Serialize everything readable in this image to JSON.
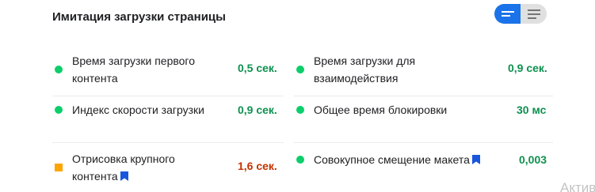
{
  "section": {
    "title": "Имитация загрузки страницы"
  },
  "metrics": [
    {
      "label_line1": "Время загрузки первого",
      "label_line2": "контента",
      "value": "0,5 сек.",
      "status": "good"
    },
    {
      "label_line1": "Время загрузки для",
      "label_line2": "взаимодействия",
      "value": "0,9 сек.",
      "status": "good"
    },
    {
      "label": "Индекс скорости загрузки",
      "value": "0,9 сек.",
      "status": "good"
    },
    {
      "label": "Общее время блокировки",
      "value": "30 мс",
      "status": "good"
    },
    {
      "label_line1": "Отрисовка крупного",
      "label_line2": "контента",
      "value": "1,6 сек.",
      "status": "average"
    },
    {
      "label": "Совокупное смещение макета",
      "value": "0,003",
      "status": "good"
    }
  ],
  "watermark": "Актив",
  "colors": {
    "good": "#0cce6b",
    "good_text": "#0d904f",
    "average": "#ffa400",
    "average_text": "#c33300",
    "accent": "#1a73e8"
  },
  "icons": {
    "toggle_left": "view-compact-icon",
    "toggle_right": "view-list-icon",
    "bookmark": "bookmark-icon"
  }
}
